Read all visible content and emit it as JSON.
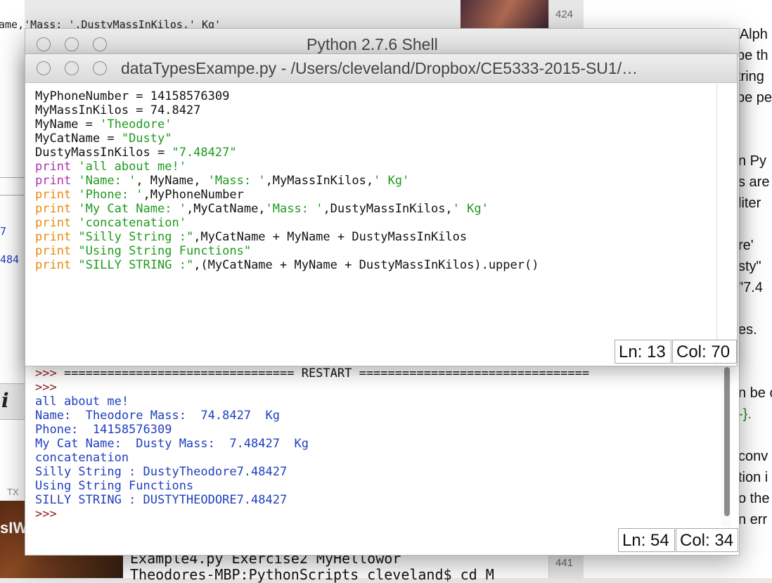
{
  "background": {
    "left_editor_lines": [
      "ame,'Mass: ',DustyMassInKilos,' Kg'",
      "7",
      "484"
    ],
    "left_italic_glyph": "i",
    "left_tx_label": "TX",
    "left_photo_text": "sIW",
    "gutter_numbers": [
      "424",
      "441"
    ],
    "right_doc_lines": [
      "'Alph",
      "pe th",
      "tring",
      "pe pe",
      "n Py",
      "s are",
      "liter",
      "re'",
      "sty\"",
      "\"7.4",
      "es.",
      "n be c",
      "-}.",
      "conv",
      "tion i",
      "o the",
      "n err"
    ],
    "terminal_lines": [
      "Example4.py       Exercise2        MyHellowor",
      "Theodores-MBP:PythonScripts cleveland$ cd M"
    ]
  },
  "shell": {
    "title": "Python 2.7.6 Shell",
    "output_lines": [
      {
        "text": ">>> ================================ RESTART ================================",
        "kind": "restart"
      },
      {
        "text": ">>> ",
        "kind": "prompt"
      },
      {
        "text": "all about me!",
        "kind": "out"
      },
      {
        "text": "Name:  Theodore Mass:  74.8427  Kg",
        "kind": "out"
      },
      {
        "text": "Phone:  14158576309",
        "kind": "out"
      },
      {
        "text": "My Cat Name:  Dusty Mass:  7.48427  Kg",
        "kind": "out"
      },
      {
        "text": "concatenation",
        "kind": "out"
      },
      {
        "text": "Silly String : DustyTheodore7.48427",
        "kind": "out"
      },
      {
        "text": "Using String Functions",
        "kind": "out"
      },
      {
        "text": "SILLY STRING : DUSTYTHEODORE7.48427",
        "kind": "out"
      },
      {
        "text": ">>> ",
        "kind": "prompt"
      }
    ],
    "status": {
      "ln": "Ln: 54",
      "col": "Col: 34"
    }
  },
  "editor": {
    "title": "dataTypesExampe.py - /Users/cleveland/Dropbox/CE5333-2015-SU1/…",
    "code_lines": [
      [
        {
          "t": "MyPhoneNumber = 14158576309",
          "c": "plain"
        }
      ],
      [
        {
          "t": "MyMassInKilos = 74.8427",
          "c": "plain"
        }
      ],
      [
        {
          "t": "MyName = ",
          "c": "plain"
        },
        {
          "t": "'Theodore'",
          "c": "str"
        }
      ],
      [
        {
          "t": "MyCatName = ",
          "c": "plain"
        },
        {
          "t": "\"Dusty\"",
          "c": "str"
        }
      ],
      [
        {
          "t": "DustyMassInKilos = ",
          "c": "plain"
        },
        {
          "t": "\"7.48427\"",
          "c": "str"
        }
      ],
      [
        {
          "t": "print",
          "c": "kw"
        },
        {
          "t": " 'all about me!'",
          "c": "str"
        }
      ],
      [
        {
          "t": "print",
          "c": "kw"
        },
        {
          "t": " 'Name: '",
          "c": "str"
        },
        {
          "t": ", MyName, ",
          "c": "plain"
        },
        {
          "t": "'Mass: '",
          "c": "str"
        },
        {
          "t": ",MyMassInKilos,",
          "c": "plain"
        },
        {
          "t": "' Kg'",
          "c": "str"
        }
      ],
      [
        {
          "t": "print",
          "c": "kw2"
        },
        {
          "t": " 'Phone: '",
          "c": "str"
        },
        {
          "t": ",MyPhoneNumber",
          "c": "plain"
        }
      ],
      [
        {
          "t": "print",
          "c": "kw2"
        },
        {
          "t": " 'My Cat Name: '",
          "c": "str"
        },
        {
          "t": ",MyCatName,",
          "c": "plain"
        },
        {
          "t": "'Mass: '",
          "c": "str"
        },
        {
          "t": ",DustyMassInKilos,",
          "c": "plain"
        },
        {
          "t": "' Kg'",
          "c": "str"
        }
      ],
      [
        {
          "t": "print",
          "c": "kw2"
        },
        {
          "t": " 'concatenation'",
          "c": "str"
        }
      ],
      [
        {
          "t": "print",
          "c": "kw2"
        },
        {
          "t": " \"Silly String :\"",
          "c": "str"
        },
        {
          "t": ",MyCatName + MyName + DustyMassInKilos",
          "c": "plain"
        }
      ],
      [
        {
          "t": "print",
          "c": "kw2"
        },
        {
          "t": " \"Using String Functions\"",
          "c": "str"
        }
      ],
      [
        {
          "t": "print",
          "c": "kw2"
        },
        {
          "t": " \"SILLY STRING :\"",
          "c": "str"
        },
        {
          "t": ",(MyCatName + MyName + DustyMassInKilos).upper()",
          "c": "plain"
        }
      ]
    ],
    "status": {
      "ln": "Ln: 13",
      "col": "Col: 70"
    }
  }
}
